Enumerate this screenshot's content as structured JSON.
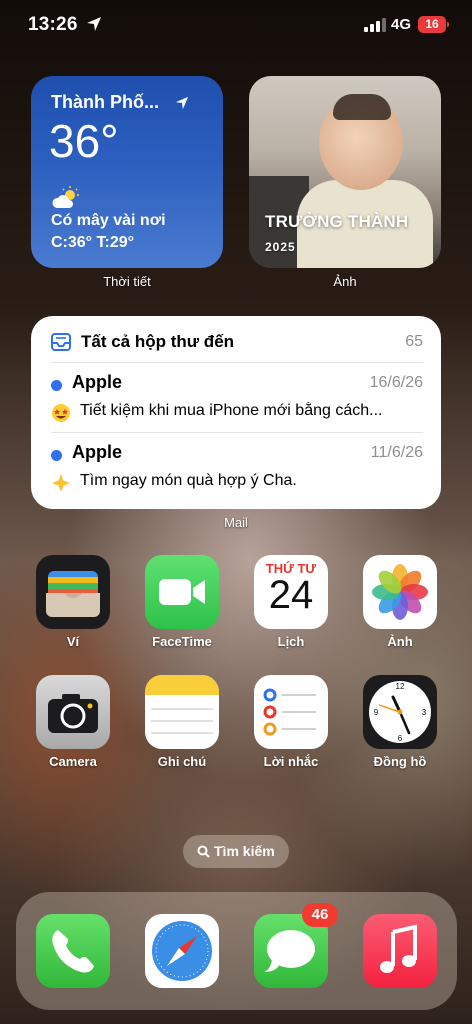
{
  "status_bar": {
    "time": "13:26",
    "network": "4G",
    "battery": "16"
  },
  "weather_widget": {
    "city": "Thành Phố...",
    "temperature": "36°",
    "condition": "Có mây vài nơi",
    "range": "C:36° T:29°",
    "label": "Thời tiết"
  },
  "photo_widget": {
    "title": "TRƯỞNG THÀNH",
    "year": "2025",
    "label": "Ảnh"
  },
  "mail_widget": {
    "title": "Tất cả hộp thư đến",
    "count": "65",
    "label": "Mail",
    "messages": [
      {
        "sender": "Apple",
        "date": "16/6/26",
        "subject": "Tiết kiệm khi mua iPhone mới bằng cách..."
      },
      {
        "sender": "Apple",
        "date": "11/6/26",
        "subject": "Tìm ngay món quà hợp ý Cha."
      }
    ]
  },
  "apps_row1": [
    {
      "label": "Ví",
      "icon": "wallet-icon"
    },
    {
      "label": "FaceTime",
      "icon": "facetime-icon"
    },
    {
      "label": "Lịch",
      "icon": "calendar-icon",
      "day": "THỨ TƯ",
      "date": "24"
    },
    {
      "label": "Ảnh",
      "icon": "photos-icon"
    }
  ],
  "apps_row2": [
    {
      "label": "Camera",
      "icon": "camera-icon"
    },
    {
      "label": "Ghi chú",
      "icon": "notes-icon"
    },
    {
      "label": "Lời nhắc",
      "icon": "reminders-icon"
    },
    {
      "label": "Đồng hồ",
      "icon": "clock-icon"
    }
  ],
  "search": {
    "label": "Tìm kiếm"
  },
  "dock": {
    "apps": [
      "phone-icon",
      "safari-icon",
      "messages-icon",
      "music-icon"
    ],
    "messages_badge": "46"
  },
  "colors": {
    "weather_bg": "#2c5fbf",
    "badge": "#f33a30",
    "mail_dot": "#2f6ff0",
    "calendar_red": "#e8362b"
  }
}
